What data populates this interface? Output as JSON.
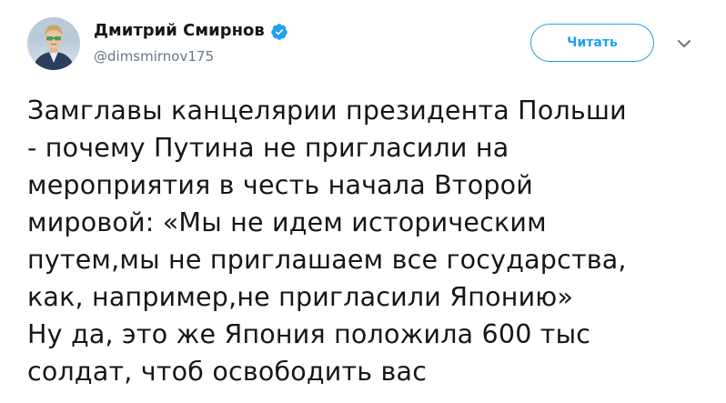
{
  "author": {
    "display_name": "Дмитрий Смирнов",
    "handle": "@dimsmirnov175",
    "verified": true,
    "verified_color": "#1da1f2"
  },
  "actions": {
    "follow_label": "Читать",
    "more_icon": "chevron-down-icon"
  },
  "tweet": {
    "lines": [
      "Замглавы канцелярии президента Польши",
      "- почему Путина не пригласили на",
      "мероприятия в честь начала Второй",
      "мировой: «Мы не идем историческим",
      "путем,мы не приглашаем все государства,",
      "как, например,не пригласили Японию»",
      "Ну да, это же Япония положила 600 тыс",
      "солдат, чтоб освободить вас"
    ]
  },
  "colors": {
    "accent": "#1da1f2",
    "text": "#14171a",
    "secondary_text": "#657786"
  }
}
